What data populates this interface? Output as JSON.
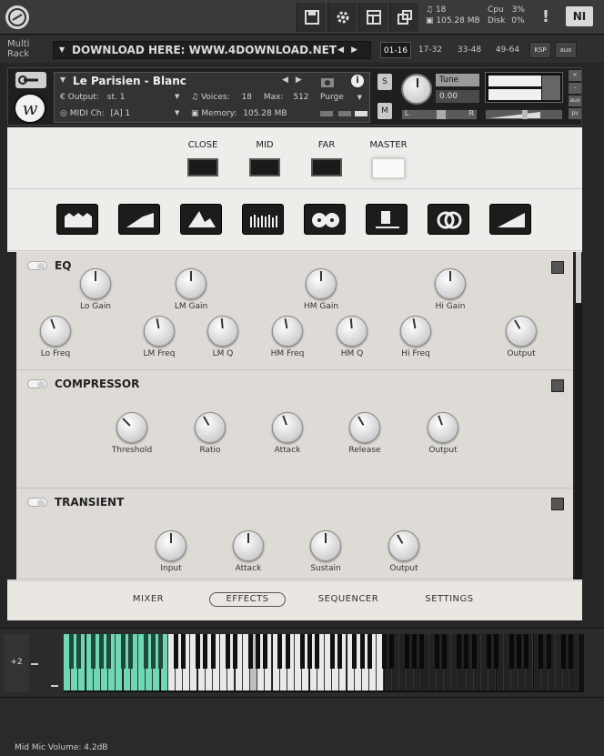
{
  "topbar": {
    "stats": {
      "voices": "18",
      "memory": "105.28 MB",
      "cpu_label": "Cpu",
      "cpu_value": "3%",
      "disk_label": "Disk",
      "disk_value": "0%"
    },
    "warning_glyph": "!",
    "brand": "NI"
  },
  "rack": {
    "label_line1": "Multi",
    "label_line2": "Rack",
    "preset": "DOWNLOAD HERE: WWW.4DOWNLOAD.NET",
    "tabs": [
      "01-16",
      "17-32",
      "33-48",
      "49-64"
    ],
    "active_tab": 0,
    "ksp": "KSP",
    "aux": "aux"
  },
  "instrument": {
    "name": "Le Parisien - Blanc",
    "output_label": "Output:",
    "output_value": "st. 1",
    "voices_label": "Voices:",
    "voices_value": "18",
    "max_label": "Max:",
    "max_value": "512",
    "purge": "Purge",
    "midi_label": "MIDI Ch:",
    "midi_value": "[A]  1",
    "memory_label": "Memory:",
    "memory_value": "105.28 MB",
    "solo": "S",
    "mute": "M",
    "tune_label": "Tune",
    "tune_value": "0.00",
    "pan_label": "L",
    "pan_right": "R",
    "side_buttons": [
      "×",
      "–",
      "aux",
      "pv"
    ]
  },
  "mics": {
    "items": [
      {
        "label": "CLOSE",
        "on": false
      },
      {
        "label": "MID",
        "on": false
      },
      {
        "label": "FAR",
        "on": false
      },
      {
        "label": "MASTER",
        "on": true
      }
    ]
  },
  "fx_icons": [
    "reverb-icon",
    "ramp-icon",
    "peak-icon",
    "equalizer-icon",
    "tape-icon",
    "amp-icon",
    "rings-icon",
    "volume-icon"
  ],
  "panels": {
    "eq": {
      "title": "EQ",
      "row1": [
        {
          "label": "Lo Gain",
          "angle": 0
        },
        {
          "label": "LM Gain",
          "angle": 0
        },
        {
          "label": "HM Gain",
          "angle": 0
        },
        {
          "label": "Hi Gain",
          "angle": 0
        }
      ],
      "row2": [
        {
          "label": "Lo Freq",
          "angle": -20
        },
        {
          "label": "LM Freq",
          "angle": -10
        },
        {
          "label": "LM Q",
          "angle": -5
        },
        {
          "label": "HM Freq",
          "angle": -10
        },
        {
          "label": "HM Q",
          "angle": -5
        },
        {
          "label": "Hi Freq",
          "angle": -10
        },
        {
          "label": "Output",
          "angle": -30
        }
      ]
    },
    "compressor": {
      "title": "COMPRESSOR",
      "knobs": [
        {
          "label": "Threshold",
          "angle": -45
        },
        {
          "label": "Ratio",
          "angle": -30
        },
        {
          "label": "Attack",
          "angle": -20
        },
        {
          "label": "Release",
          "angle": -30
        },
        {
          "label": "Output",
          "angle": -20
        }
      ]
    },
    "transient": {
      "title": "TRANSIENT",
      "knobs": [
        {
          "label": "Input",
          "angle": 0
        },
        {
          "label": "Attack",
          "angle": 0
        },
        {
          "label": "Sustain",
          "angle": 0
        },
        {
          "label": "Output",
          "angle": -30
        }
      ]
    }
  },
  "nav": {
    "items": [
      "MIXER",
      "EFFECTS",
      "SEQUENCER",
      "SETTINGS"
    ],
    "active": "EFFECTS"
  },
  "keyboard": {
    "octave": "+2",
    "colors": {
      "mapped": "#6fd7b2",
      "active": "#e9e9e9",
      "inactive": "#222222"
    }
  },
  "status": {
    "text": "Mid Mic Volume: 4.2dB"
  }
}
